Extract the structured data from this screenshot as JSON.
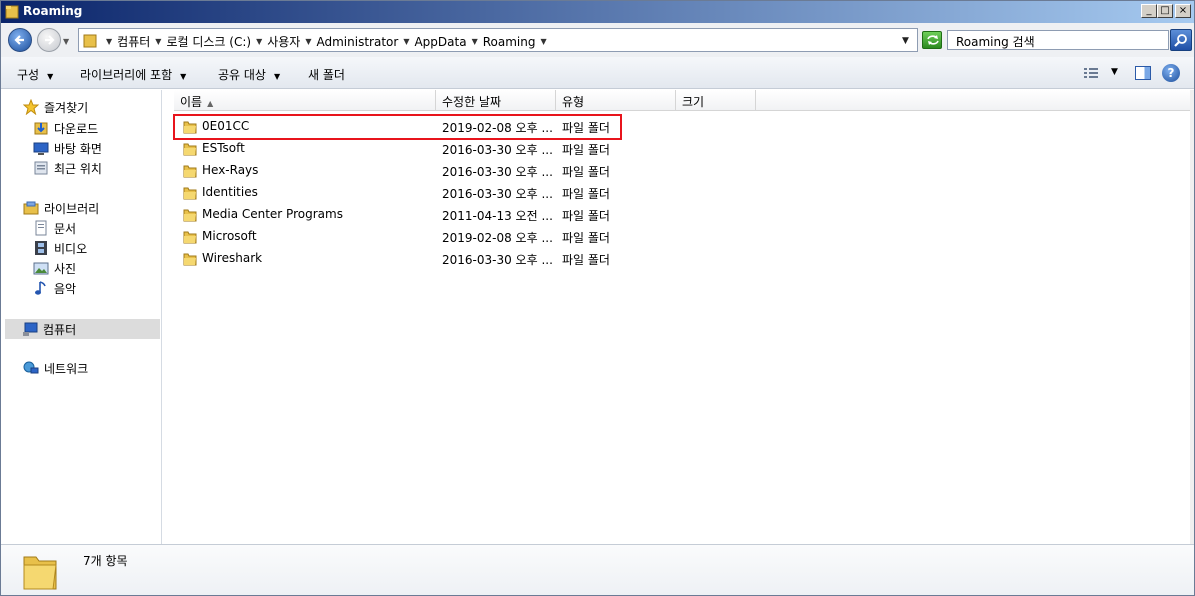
{
  "window": {
    "title": "Roaming"
  },
  "address": {
    "crumbs": [
      "컴퓨터",
      "로컬 디스크 (C:)",
      "사용자",
      "Administrator",
      "AppData",
      "Roaming"
    ],
    "search_placeholder": "Roaming 검색"
  },
  "toolbar": {
    "organize": "구성",
    "include_library": "라이브러리에 포함",
    "share_with": "공유 대상",
    "new_folder": "새 폴더"
  },
  "nav": {
    "favorites": "즐겨찾기",
    "downloads": "다운로드",
    "desktop": "바탕 화면",
    "recent": "최근 위치",
    "libraries": "라이브러리",
    "documents": "문서",
    "videos": "비디오",
    "pictures": "사진",
    "music": "음악",
    "computer": "컴퓨터",
    "network": "네트워크"
  },
  "columns": {
    "name": "이름",
    "modified": "수정한 날짜",
    "type": "유형",
    "size": "크기"
  },
  "files": [
    {
      "name": "0E01CC",
      "modified": "2019-02-08 오후 ...",
      "type": "파일 폴더"
    },
    {
      "name": "ESTsoft",
      "modified": "2016-03-30 오후 ...",
      "type": "파일 폴더"
    },
    {
      "name": "Hex-Rays",
      "modified": "2016-03-30 오후 ...",
      "type": "파일 폴더"
    },
    {
      "name": "Identities",
      "modified": "2016-03-30 오후 ...",
      "type": "파일 폴더"
    },
    {
      "name": "Media Center Programs",
      "modified": "2011-04-13 오전 ...",
      "type": "파일 폴더"
    },
    {
      "name": "Microsoft",
      "modified": "2019-02-08 오후 ...",
      "type": "파일 폴더"
    },
    {
      "name": "Wireshark",
      "modified": "2016-03-30 오후 ...",
      "type": "파일 폴더"
    }
  ],
  "status": {
    "item_count": "7개 항목"
  },
  "colors": {
    "highlight": "#e8141c",
    "titlebar_start": "#0a246a",
    "titlebar_end": "#a6caf0"
  }
}
